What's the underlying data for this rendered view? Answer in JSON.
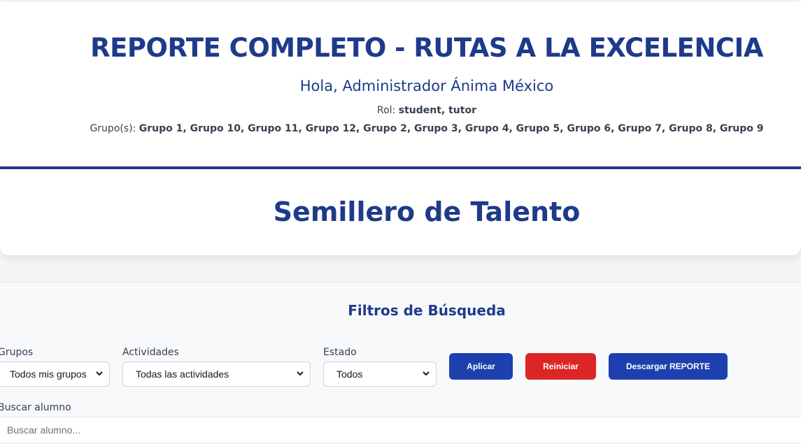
{
  "header": {
    "title": "REPORTE COMPLETO - RUTAS A LA EXCELENCIA",
    "greeting": "Hola, Administrador Ánima México",
    "role_label": "Rol: ",
    "role_value": "student, tutor",
    "groups_label": "Grupo(s): ",
    "groups_value": "Grupo 1, Grupo 10, Grupo 11, Grupo 12, Grupo 2, Grupo 3, Grupo 4, Grupo 5, Grupo 6, Grupo 7, Grupo 8, Grupo 9"
  },
  "section": {
    "title": "Semillero de Talento"
  },
  "filters": {
    "title": "Filtros de Búsqueda",
    "groups_label": "Grupos",
    "groups_selected": "Todos mis grupos",
    "activities_label": "Actividades",
    "activities_selected": "Todas las actividades",
    "status_label": "Estado",
    "status_selected": "Todos",
    "apply_label": "Aplicar",
    "reset_label": "Reiniciar",
    "download_label": "Descargar REPORTE",
    "search_label": "Buscar alumno",
    "search_placeholder": "Buscar alumno..."
  },
  "colors": {
    "primary": "#1e3a8a",
    "button_blue": "#1e40af",
    "button_red": "#dc2626"
  }
}
